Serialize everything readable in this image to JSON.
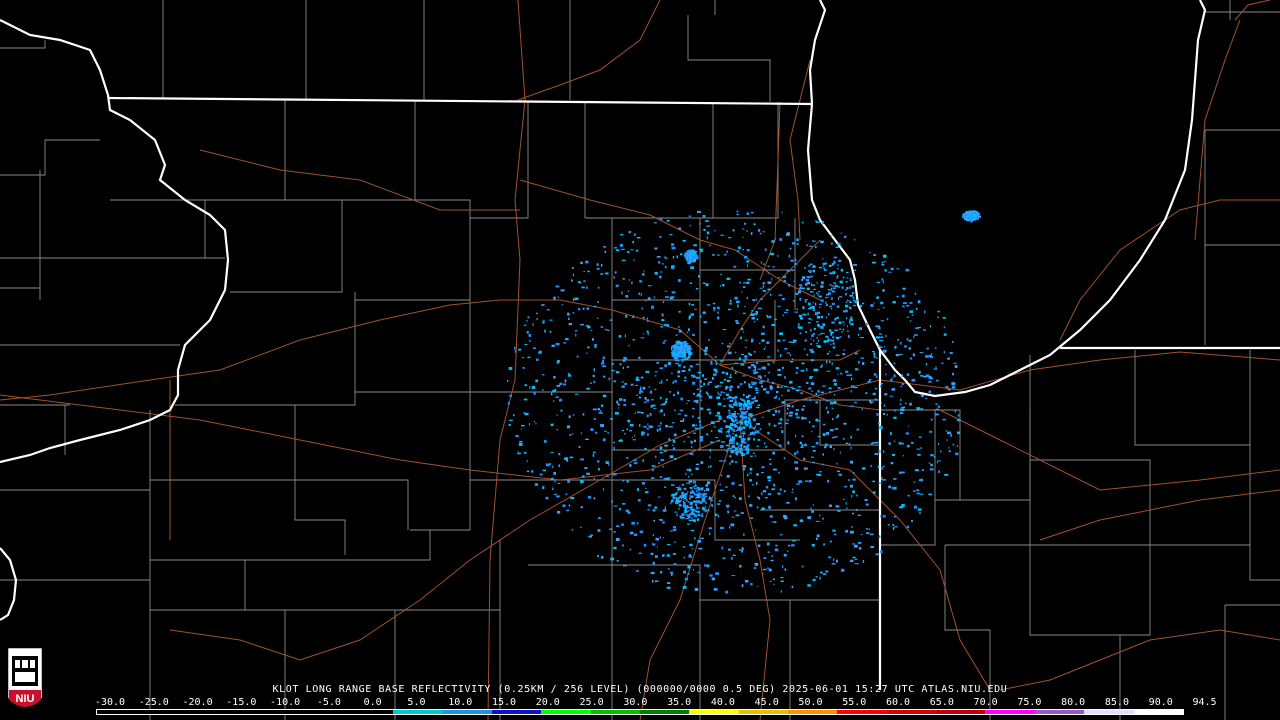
{
  "caption": "KLOT LONG RANGE BASE REFLECTIVITY (0.25KM / 256 LEVEL) (000000/0000 0.5 DEG) 2025-06-01 15:27 UTC  ATLAS.NIU.EDU",
  "scale_labels": [
    "-30.0",
    "-25.0",
    "-20.0",
    "-15.0",
    "-10.0",
    "-5.0",
    "0.0",
    "5.0",
    "10.0",
    "15.0",
    "20.0",
    "25.0",
    "30.0",
    "35.0",
    "40.0",
    "45.0",
    "50.0",
    "55.0",
    "60.0",
    "65.0",
    "70.0",
    "75.0",
    "80.0",
    "85.0",
    "90.0",
    "94.5"
  ],
  "scale_colors": [
    "#000000",
    "#000000",
    "#000000",
    "#000000",
    "#000000",
    "#000000",
    "#00c8c8",
    "#2090e0",
    "#1010d0",
    "#00ff00",
    "#00c000",
    "#008000",
    "#ffff00",
    "#e7c000",
    "#ff9000",
    "#ff0000",
    "#d60000",
    "#c00000",
    "#ff00ff",
    "#9955c9",
    "#e0e0ff",
    "#ffffff"
  ],
  "logo": {
    "text": "NIU",
    "color": "#c8102e"
  },
  "map": {
    "background": "#000000",
    "state_border_color": "#ffffff",
    "county_border_color": "#8a8a8a",
    "highway_color": "#a0522d",
    "echo_colors": [
      "#1e90ff",
      "#00bfff",
      "#3aa0ff"
    ]
  }
}
